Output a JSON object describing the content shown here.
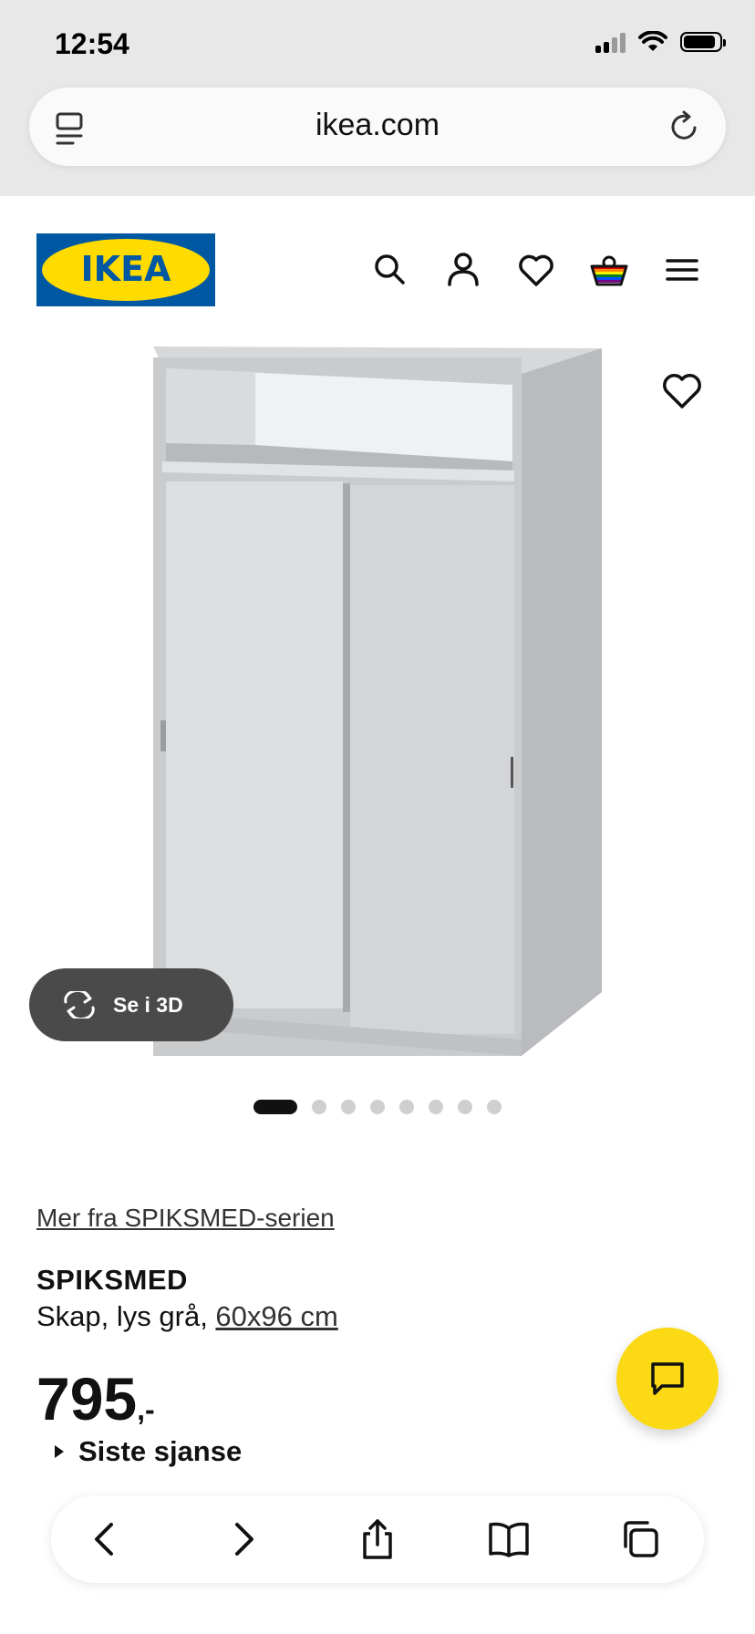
{
  "status_bar": {
    "time": "12:54"
  },
  "browser": {
    "url": "ikea.com"
  },
  "brand": {
    "logo_text": "IKEA",
    "logo_blue": "#0058a3",
    "logo_yellow": "#ffdb00"
  },
  "header": {
    "icons": [
      "search-icon",
      "account-icon",
      "favourites-icon",
      "cart-icon",
      "menu-icon"
    ]
  },
  "gallery": {
    "view_3d_label": "Se i 3D",
    "image_count": 8,
    "active_index": 0
  },
  "product": {
    "series_link": "Mer fra SPIKSMED-serien",
    "name": "SPIKSMED",
    "description_prefix": "Skap, lys grå, ",
    "size_link": "60x96 cm",
    "price_amount": "795",
    "price_suffix": ",-",
    "availability": "Siste sjanse"
  },
  "colors": {
    "accent_yellow": "#fbd914",
    "dark_pill": "#4a4a4a"
  }
}
